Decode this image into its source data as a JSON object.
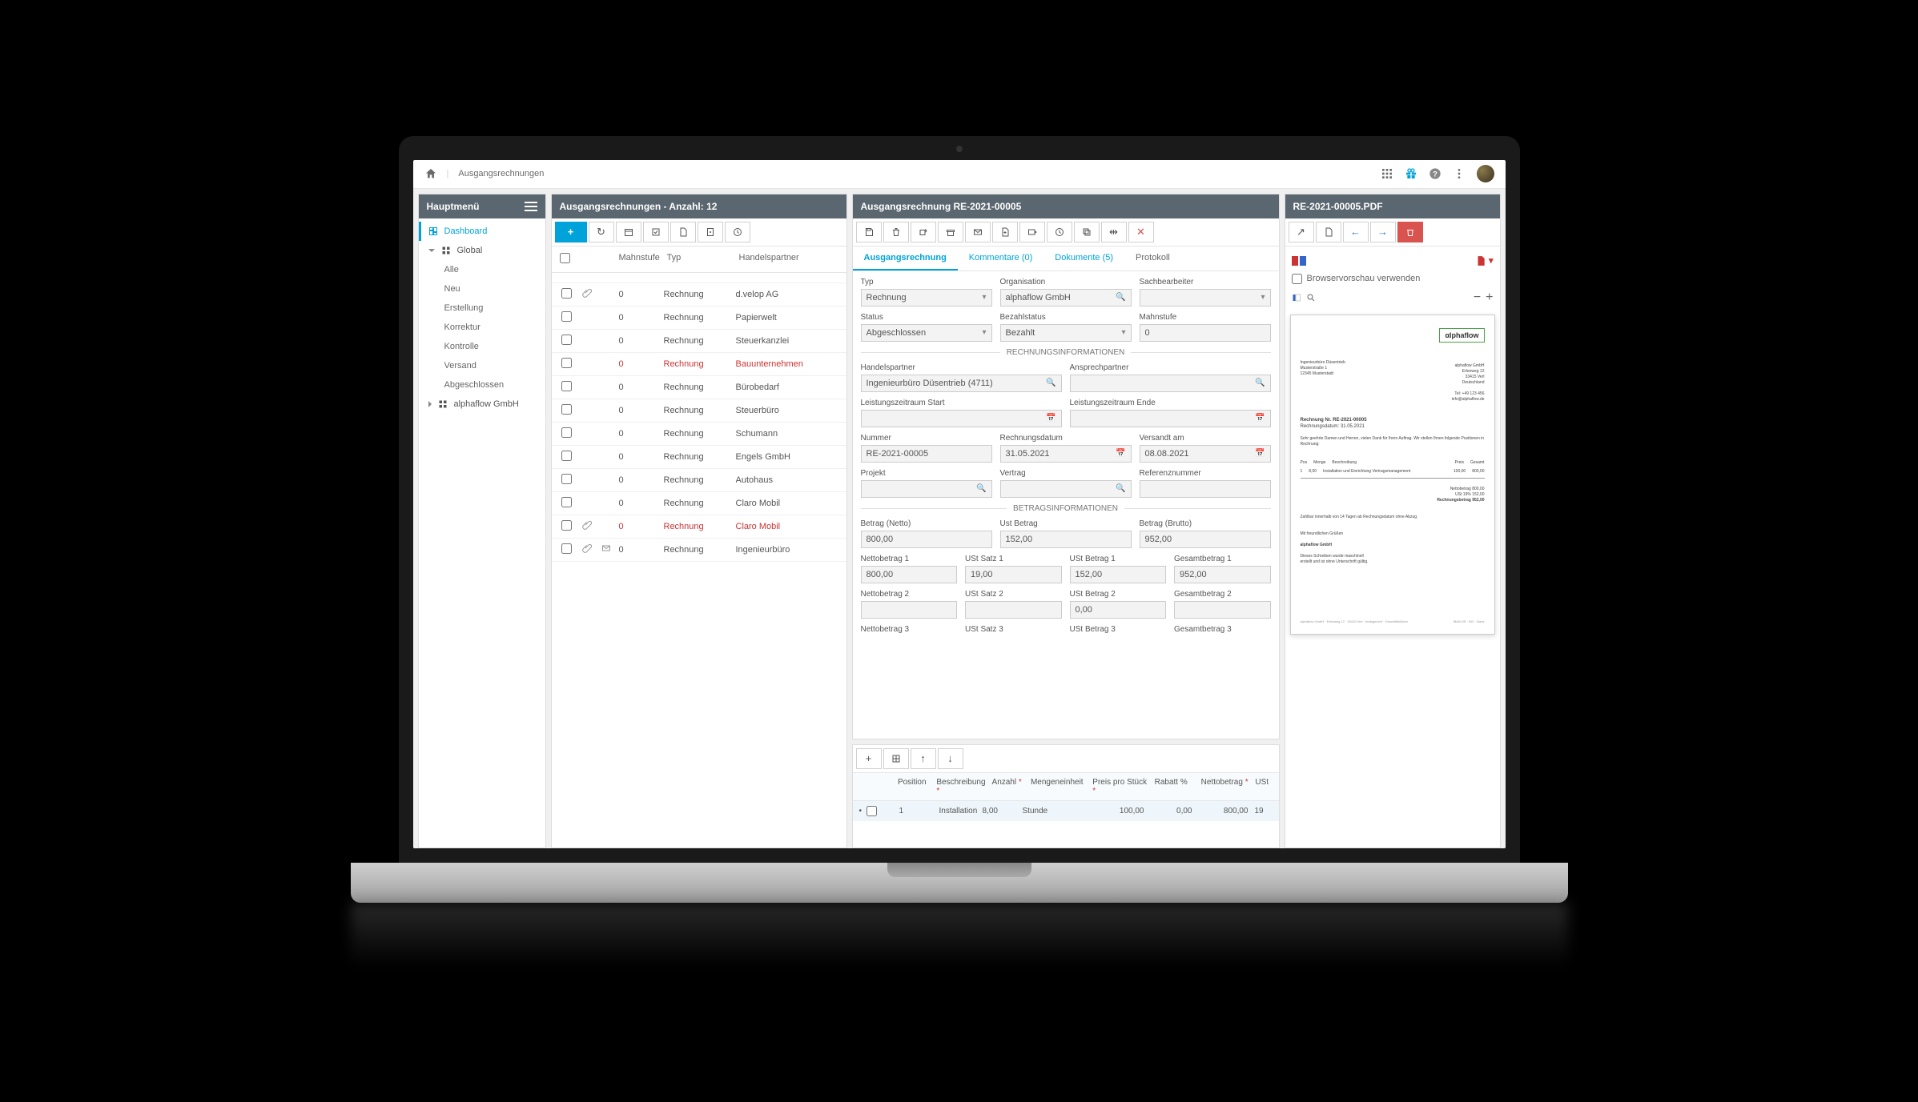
{
  "breadcrumb": "Ausgangsrechnungen",
  "topIcons": {
    "apps": "apps",
    "gift": "gift",
    "help": "?"
  },
  "sidebar": {
    "title": "Hauptmenü",
    "dashboard": "Dashboard",
    "global": "Global",
    "items": [
      "Alle",
      "Neu",
      "Erstellung",
      "Korrektur",
      "Kontrolle",
      "Versand",
      "Abgeschlossen"
    ],
    "org": "alphaflow GmbH"
  },
  "list": {
    "title": "Ausgangsrechnungen - Anzahl: 12",
    "headers": {
      "mahnstufe": "Mahnstufe",
      "typ": "Typ",
      "hp": "Handelspartner"
    },
    "rows": [
      {
        "ms": "",
        "typ": "",
        "hp": "",
        "att": false,
        "env": false,
        "red": false,
        "noCheck": true
      },
      {
        "ms": "0",
        "typ": "Rechnung",
        "hp": "d.velop AG",
        "att": true,
        "env": false,
        "red": false
      },
      {
        "ms": "0",
        "typ": "Rechnung",
        "hp": "Papierwelt",
        "att": false,
        "env": false,
        "red": false
      },
      {
        "ms": "0",
        "typ": "Rechnung",
        "hp": "Steuerkanzlei",
        "att": false,
        "env": false,
        "red": false
      },
      {
        "ms": "0",
        "typ": "Rechnung",
        "hp": "Bauunternehmen",
        "att": false,
        "env": false,
        "red": true
      },
      {
        "ms": "0",
        "typ": "Rechnung",
        "hp": "Bürobedarf",
        "att": false,
        "env": false,
        "red": false
      },
      {
        "ms": "0",
        "typ": "Rechnung",
        "hp": "Steuerbüro",
        "att": false,
        "env": false,
        "red": false
      },
      {
        "ms": "0",
        "typ": "Rechnung",
        "hp": "Schumann",
        "att": false,
        "env": false,
        "red": false
      },
      {
        "ms": "0",
        "typ": "Rechnung",
        "hp": "Engels GmbH",
        "att": false,
        "env": false,
        "red": false
      },
      {
        "ms": "0",
        "typ": "Rechnung",
        "hp": "Autohaus",
        "att": false,
        "env": false,
        "red": false
      },
      {
        "ms": "0",
        "typ": "Rechnung",
        "hp": "Claro Mobil",
        "att": false,
        "env": false,
        "red": false
      },
      {
        "ms": "0",
        "typ": "Rechnung",
        "hp": "Claro Mobil",
        "att": true,
        "env": false,
        "red": true
      },
      {
        "ms": "0",
        "typ": "Rechnung",
        "hp": "Ingenieurbüro",
        "att": true,
        "env": true,
        "red": false
      }
    ]
  },
  "detail": {
    "title": "Ausgangsrechnung RE-2021-00005",
    "tabs": {
      "t1": "Ausgangsrechnung",
      "t2": "Kommentare (0)",
      "t3": "Dokumente (5)",
      "t4": "Protokoll"
    },
    "labels": {
      "typ": "Typ",
      "org": "Organisation",
      "sach": "Sachbearbeiter",
      "status": "Status",
      "bezahl": "Bezahlstatus",
      "mahn": "Mahnstufe",
      "sect1": "RECHNUNGSINFORMATIONEN",
      "hp": "Handelspartner",
      "ansp": "Ansprechpartner",
      "lzStart": "Leistungszeitraum Start",
      "lzEnde": "Leistungszeitraum Ende",
      "nummer": "Nummer",
      "rdatum": "Rechnungsdatum",
      "versandt": "Versandt am",
      "projekt": "Projekt",
      "vertrag": "Vertrag",
      "ref": "Referenznummer",
      "sect2": "BETRAGSINFORMATIONEN",
      "netto": "Betrag (Netto)",
      "ust": "Ust Betrag",
      "brutto": "Betrag (Brutto)",
      "nb1": "Nettobetrag 1",
      "us1": "USt Satz 1",
      "ub1": "USt Betrag 1",
      "gb1": "Gesamtbetrag 1",
      "nb2": "Nettobetrag 2",
      "us2": "USt Satz 2",
      "ub2": "USt Betrag 2",
      "gb2": "Gesamtbetrag 2",
      "nb3": "Nettobetrag 3",
      "us3": "USt Satz 3",
      "ub3": "USt Betrag 3",
      "gb3": "Gesamtbetrag 3"
    },
    "values": {
      "typ": "Rechnung",
      "org": "alphaflow GmbH",
      "sach": "",
      "status": "Abgeschlossen",
      "bezahl": "Bezahlt",
      "mahn": "0",
      "hp": "Ingenieurbüro Düsentrieb (4711)",
      "ansp": "",
      "lzStart": "",
      "lzEnde": "",
      "nummer": "RE-2021-00005",
      "rdatum": "31.05.2021",
      "versandt": "08.08.2021",
      "projekt": "",
      "vertrag": "",
      "ref": "",
      "netto": "800,00",
      "ust": "152,00",
      "brutto": "952,00",
      "nb1": "800,00",
      "us1": "19,00",
      "ub1": "152,00",
      "gb1": "952,00",
      "nb2": "",
      "us2": "",
      "ub2": "0,00",
      "gb2": "",
      "nb3": "",
      "us3": "",
      "ub3": "",
      "gb3": ""
    }
  },
  "lineItems": {
    "headers": {
      "pos": "Position",
      "beschr": "Beschreibung",
      "anz": "Anzahl",
      "me": "Mengeneinheit",
      "pps": "Preis pro Stück",
      "rabatt": "Rabatt %",
      "nb": "Nettobetrag",
      "us": "USt"
    },
    "row": {
      "pos": "1",
      "beschr": "Installation und Einrichtung Vertragsmanagement",
      "anz": "8,00",
      "me": "Stunde",
      "pps": "100,00",
      "rabatt": "0,00",
      "nb": "800,00",
      "us": "19"
    }
  },
  "preview": {
    "title": "RE-2021-00005.PDF",
    "browserPreview": "Browservorschau verwenden",
    "logo": "αlphaflow"
  }
}
